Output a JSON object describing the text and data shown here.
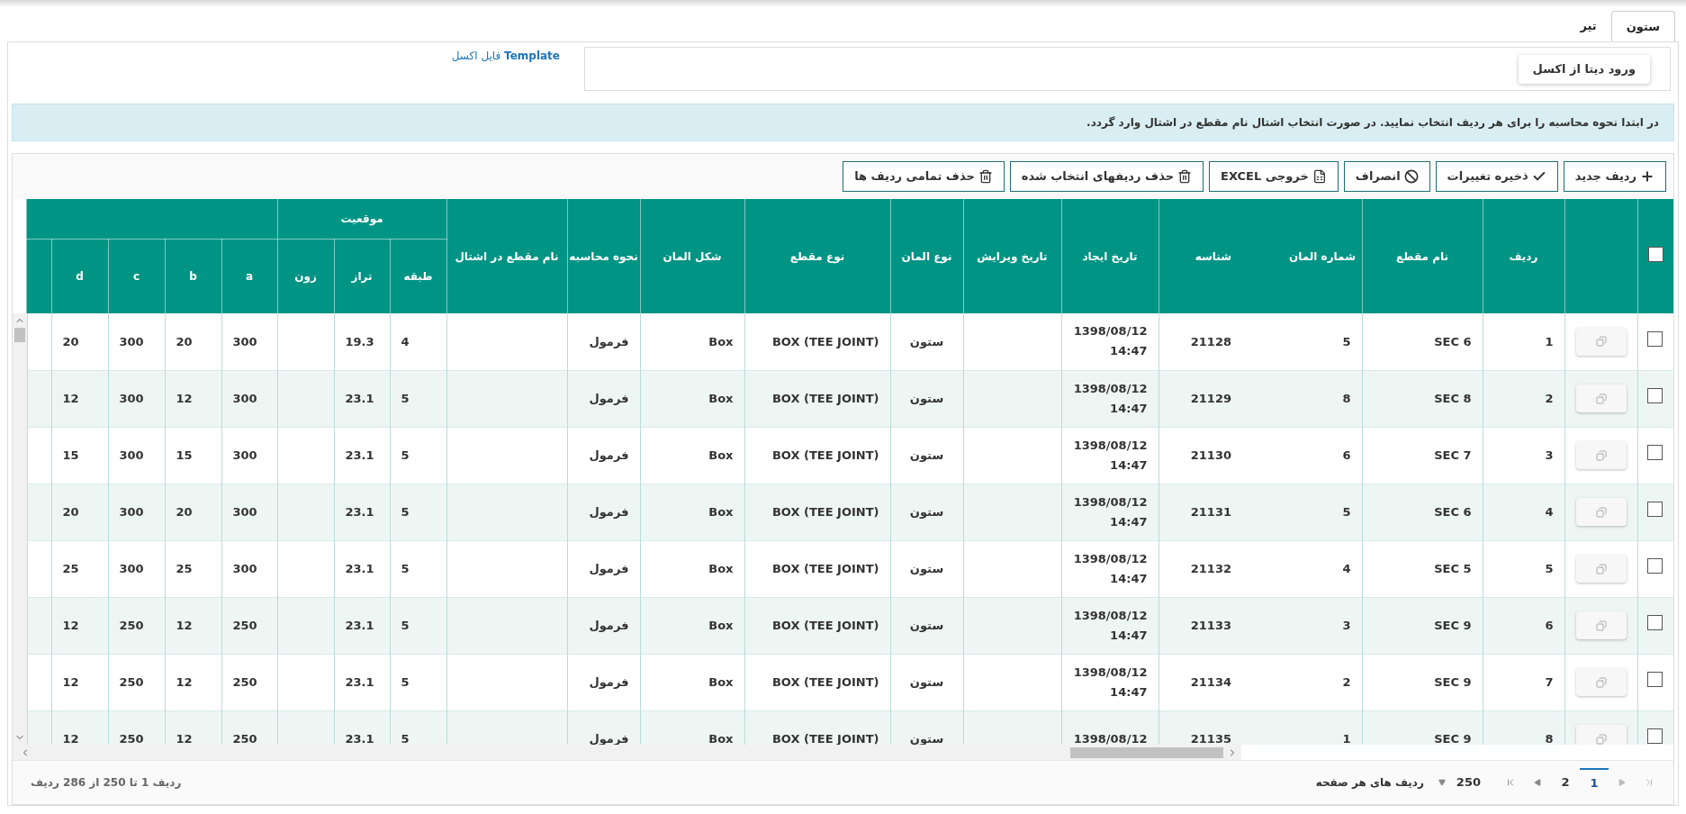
{
  "tabs": [
    {
      "label": "ستون",
      "selected": true
    },
    {
      "label": "تیر",
      "selected": false
    }
  ],
  "excel_import": {
    "button": "ورود دیتا از اکسل",
    "template_link": "**Template** فایل اکسل"
  },
  "alert": "در ابتدا نحوه محاسبه را برای هر ردیف انتخاب نمایید. در صورت انتخاب اشتال نام مقطع در اشتال وارد گردد.",
  "toolbar": [
    {
      "kind": "add",
      "label": "ردیف جدید"
    },
    {
      "kind": "save",
      "label": "ذخیره تغییرات"
    },
    {
      "kind": "cancel",
      "label": "انصراف"
    },
    {
      "kind": "excel",
      "label": "خروجی EXCEL"
    },
    {
      "kind": "delete",
      "label": "حذف ردیفهای انتخاب شده"
    },
    {
      "kind": "delete",
      "label": "حذف تمامی ردیف ها"
    }
  ],
  "table": {
    "select_all_checked": false,
    "columns": [
      "ردیف",
      "نام مقطع",
      "شماره المان",
      "شناسه",
      "تاریخ ایجاد",
      "تاریخ ویرایش",
      "نوع المان",
      "نوع مقطع",
      "شکل المان",
      "نحوه محاسبه",
      "نام مقطع در اشتال"
    ],
    "group_header": "موقعیت",
    "group_columns": [
      "طبقه",
      "تراز",
      "زون"
    ],
    "dimension_columns": [
      "a",
      "b",
      "c",
      "d"
    ],
    "rows": [
      {
        "checked": false,
        "row": "1",
        "section": "SEC 6",
        "element_no": "5",
        "id": "21128",
        "created_date": "1398/08/12",
        "created_time": "14:47",
        "element_type": "ستون",
        "section_type": "BOX (TEE JOINT)",
        "shape": "Box",
        "method": "فرمول",
        "floor": "4",
        "elevation": "19.3",
        "a": "300",
        "b": "20",
        "c": "300",
        "d": "20"
      },
      {
        "checked": false,
        "row": "2",
        "section": "SEC 8",
        "element_no": "8",
        "id": "21129",
        "created_date": "1398/08/12",
        "created_time": "14:47",
        "element_type": "ستون",
        "section_type": "BOX (TEE JOINT)",
        "shape": "Box",
        "method": "فرمول",
        "floor": "5",
        "elevation": "23.1",
        "a": "300",
        "b": "12",
        "c": "300",
        "d": "12"
      },
      {
        "checked": false,
        "row": "3",
        "section": "SEC 7",
        "element_no": "6",
        "id": "21130",
        "created_date": "1398/08/12",
        "created_time": "14:47",
        "element_type": "ستون",
        "section_type": "BOX (TEE JOINT)",
        "shape": "Box",
        "method": "فرمول",
        "floor": "5",
        "elevation": "23.1",
        "a": "300",
        "b": "15",
        "c": "300",
        "d": "15"
      },
      {
        "checked": false,
        "row": "4",
        "section": "SEC 6",
        "element_no": "5",
        "id": "21131",
        "created_date": "1398/08/12",
        "created_time": "14:47",
        "element_type": "ستون",
        "section_type": "BOX (TEE JOINT)",
        "shape": "Box",
        "method": "فرمول",
        "floor": "5",
        "elevation": "23.1",
        "a": "300",
        "b": "20",
        "c": "300",
        "d": "20"
      },
      {
        "checked": false,
        "row": "5",
        "section": "SEC 5",
        "element_no": "4",
        "id": "21132",
        "created_date": "1398/08/12",
        "created_time": "14:47",
        "element_type": "ستون",
        "section_type": "BOX (TEE JOINT)",
        "shape": "Box",
        "method": "فرمول",
        "floor": "5",
        "elevation": "23.1",
        "a": "300",
        "b": "25",
        "c": "300",
        "d": "25"
      },
      {
        "checked": false,
        "row": "6",
        "section": "SEC 9",
        "element_no": "3",
        "id": "21133",
        "created_date": "1398/08/12",
        "created_time": "14:47",
        "element_type": "ستون",
        "section_type": "BOX (TEE JOINT)",
        "shape": "Box",
        "method": "فرمول",
        "floor": "5",
        "elevation": "23.1",
        "a": "250",
        "b": "12",
        "c": "250",
        "d": "12"
      },
      {
        "checked": false,
        "row": "7",
        "section": "SEC 9",
        "element_no": "2",
        "id": "21134",
        "created_date": "1398/08/12",
        "created_time": "14:47",
        "element_type": "ستون",
        "section_type": "BOX (TEE JOINT)",
        "shape": "Box",
        "method": "فرمول",
        "floor": "5",
        "elevation": "23.1",
        "a": "250",
        "b": "12",
        "c": "250",
        "d": "12"
      },
      {
        "checked": false,
        "row": "8",
        "section": "SEC 9",
        "element_no": "1",
        "id": "21135",
        "created_date": "1398/08/12",
        "element_type": "ستون",
        "section_type": "BOX (TEE JOINT)",
        "shape": "Box",
        "method": "فرمول",
        "floor": "5",
        "elevation": "23.1",
        "a": "250",
        "b": "12",
        "c": "250",
        "d": "12"
      }
    ]
  },
  "pager": {
    "pages": [
      {
        "label": "1",
        "selected": true
      },
      {
        "label": "2",
        "selected": false
      }
    ],
    "page_size": "250",
    "page_size_label": "ردیف های هر صفحه",
    "summary": "ردیف 1 تا 250 از 286 ردیف"
  }
}
